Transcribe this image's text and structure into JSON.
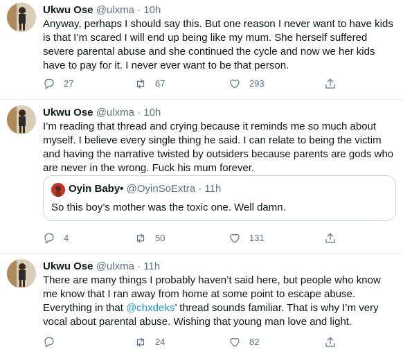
{
  "colors": {
    "text": "#0f1419",
    "secondary": "#5b7083",
    "link": "#1b95e0",
    "border": "#e6ecf0"
  },
  "tweets": [
    {
      "name": "Ukwu Ose",
      "handle": "@ulxma",
      "separator": "·",
      "time": "10h",
      "text": "Anyway, perhaps I should say this. But one reason I never want to have kids is that I’m scared I will end up being like my mum. She herself suffered severe parental abuse and she continued the cycle and now we her kids have to pay for it. I never ever want to be that person.",
      "replies": "27",
      "retweets": "67",
      "likes": "293"
    },
    {
      "name": "Ukwu Ose",
      "handle": "@ulxma",
      "separator": "·",
      "time": "10h",
      "text": "I’m reading that thread and crying because it reminds me so much about myself. I believe every single thing he said. I can relate to being the victim and having the narrative twisted by outsiders because parents are gods who are never in the wrong. Fuck his mum forever.",
      "quote": {
        "name": "Oyin Baby•",
        "handle": "@OyinSoExtra",
        "separator": "·",
        "time": "11h",
        "text": "So this boy’s mother was the toxic one. Well damn."
      },
      "replies": "4",
      "retweets": "50",
      "likes": "131"
    },
    {
      "name": "Ukwu Ose",
      "handle": "@ulxma",
      "separator": "·",
      "time": "11h",
      "text_before": "There are many things I probably haven’t said here, but people who know me know that I ran away from home at some point to escape abuse. Everything in that ",
      "mention": "@chxdeks",
      "text_after": "’ thread sounds familiar. That is why I’m very vocal about parental abuse. Wishing that young man love and light.",
      "replies": "",
      "retweets": "24",
      "likes": "82"
    }
  ],
  "icons": {
    "reply": "reply-icon",
    "retweet": "retweet-icon",
    "like": "heart-icon",
    "share": "share-icon"
  }
}
